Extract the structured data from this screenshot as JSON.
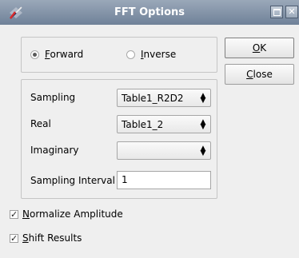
{
  "window": {
    "title": "FFT Options",
    "icon": "fft-app-icon",
    "maximize_icon": "maximize-icon",
    "close_icon": "close-icon",
    "close_glyph": "✕"
  },
  "direction": {
    "forward": {
      "accel": "F",
      "rest": "orward",
      "checked": true
    },
    "inverse": {
      "accel": "I",
      "rest": "nverse",
      "checked": false
    }
  },
  "buttons": {
    "ok": {
      "accel": "O",
      "rest": "K"
    },
    "close": {
      "accel": "C",
      "rest": "lose"
    }
  },
  "fields": {
    "sampling": {
      "label": "Sampling",
      "value": "Table1_R2D2"
    },
    "real": {
      "label": "Real",
      "value": "Table1_2"
    },
    "imaginary": {
      "label": "Imaginary",
      "value": ""
    },
    "sampling_interval": {
      "label": "Sampling Interval",
      "value": "1"
    }
  },
  "options": {
    "normalize": {
      "accel": "N",
      "rest": "ormalize Amplitude",
      "checked": true,
      "check_glyph": "✓"
    },
    "shift": {
      "accel": "S",
      "rest": "hift Results",
      "checked": true,
      "check_glyph": "✓"
    }
  }
}
